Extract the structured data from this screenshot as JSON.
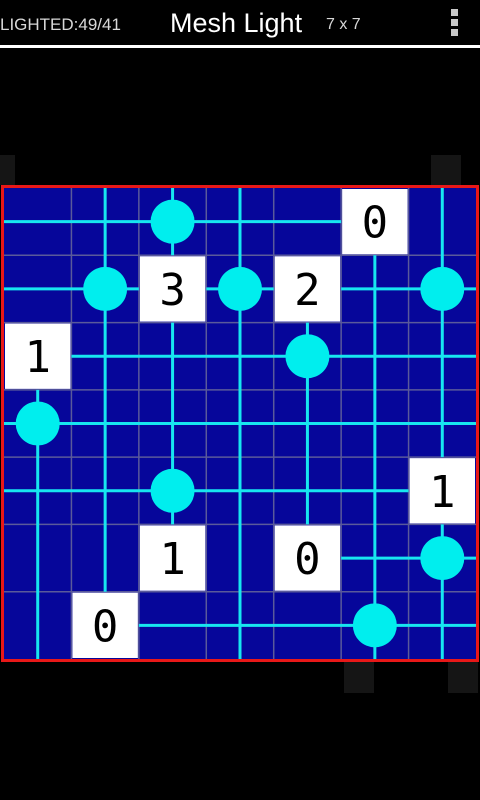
{
  "header": {
    "lighted_label": "LIGHTED:49/41",
    "title": "Mesh Light",
    "size_label": "7 x 7",
    "menu_icon": "overflow-menu-icon"
  },
  "board": {
    "rows": 7,
    "cols": 7,
    "colors": {
      "background": "#06069a",
      "border": "#e81818",
      "grid": "#5a5a9a",
      "beam": "#17e6f0",
      "bulb": "#00eeee",
      "wall_fill": "#ffffff",
      "wall_digit": "#000000"
    },
    "walls": [
      {
        "row": 0,
        "col": 5,
        "number": "0"
      },
      {
        "row": 1,
        "col": 2,
        "number": "3"
      },
      {
        "row": 1,
        "col": 4,
        "number": "2"
      },
      {
        "row": 2,
        "col": 0,
        "number": "1"
      },
      {
        "row": 4,
        "col": 6,
        "number": "1"
      },
      {
        "row": 5,
        "col": 2,
        "number": "1"
      },
      {
        "row": 5,
        "col": 4,
        "number": "0"
      },
      {
        "row": 6,
        "col": 1,
        "number": "0"
      }
    ],
    "bulbs": [
      {
        "row": 0,
        "col": 2
      },
      {
        "row": 1,
        "col": 1
      },
      {
        "row": 1,
        "col": 3
      },
      {
        "row": 1,
        "col": 6
      },
      {
        "row": 2,
        "col": 4
      },
      {
        "row": 3,
        "col": 0
      },
      {
        "row": 4,
        "col": 2
      },
      {
        "row": 5,
        "col": 6
      },
      {
        "row": 6,
        "col": 5
      }
    ]
  }
}
